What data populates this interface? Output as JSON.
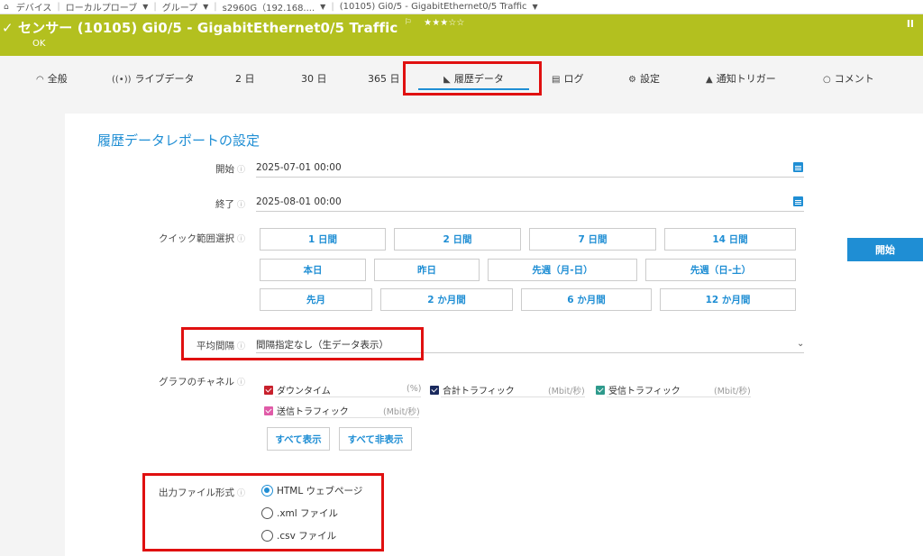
{
  "breadcrumb": [
    {
      "label": "デバイス",
      "caret": false
    },
    {
      "label": "ローカルプローブ",
      "caret": true
    },
    {
      "label": "グループ",
      "caret": true
    },
    {
      "label": "s2960G（192.168....",
      "caret": true
    },
    {
      "label": "(10105) Gi0/5 - GigabitEthernet0/5 Traffic",
      "caret": true
    }
  ],
  "header": {
    "check": "✓",
    "title": "センサー (10105) Gi0/5 - GigabitEthernet0/5 Traffic",
    "stars": "★★★☆☆",
    "status": "OK",
    "pause": "II"
  },
  "tabs": [
    {
      "label": "全般",
      "icon": "gauge-icon"
    },
    {
      "label": "ライブデータ",
      "icon": "broadcast-icon"
    },
    {
      "label": "2 日",
      "icon": ""
    },
    {
      "label": "30 日",
      "icon": ""
    },
    {
      "label": "365 日",
      "icon": ""
    },
    {
      "label": "履歴データ",
      "icon": "area-chart-icon",
      "active": true
    },
    {
      "label": "ログ",
      "icon": "list-icon"
    },
    {
      "label": "設定",
      "icon": "gear-icon"
    },
    {
      "label": "通知トリガー",
      "icon": "bell-icon"
    },
    {
      "label": "コメント",
      "icon": "comment-icon"
    }
  ],
  "form": {
    "title": "履歴データレポートの設定",
    "start_label": "開始",
    "start_value": "2025-07-01 00:00",
    "end_label": "終了",
    "end_value": "2025-08-01 00:00",
    "quick_label": "クイック範囲選択",
    "quick_row1": [
      "1 日間",
      "2 日間",
      "7 日間",
      "14 日間"
    ],
    "quick_row2": [
      "本日",
      "昨日",
      "先週（月-日）",
      "先週（日-土）"
    ],
    "quick_row3": [
      "先月",
      "2 か月間",
      "6 か月間",
      "12 か月間"
    ],
    "avg_label": "平均間隔",
    "avg_value": "間隔指定なし（生データ表示）",
    "channels_label": "グラフのチャネル",
    "channels": [
      {
        "name": "ダウンタイム",
        "unit": "(%)",
        "color": "#c8202c"
      },
      {
        "name": "合計トラフィック",
        "unit": "(Mbit/秒)",
        "color": "#1a2a5e"
      },
      {
        "name": "受信トラフィック",
        "unit": "(Mbit/秒)",
        "color": "#2e9a8c"
      },
      {
        "name": "送信トラフィック",
        "unit": "(Mbit/秒)",
        "color": "#e05ba8"
      }
    ],
    "show_all": "すべて表示",
    "hide_all": "すべて非表示",
    "format_label": "出力ファイル形式",
    "formats": [
      {
        "label": "HTML ウェブページ",
        "selected": true
      },
      {
        "label": ".xml ファイル",
        "selected": false
      },
      {
        "label": ".csv ファイル",
        "selected": false
      }
    ],
    "submit": "開始"
  },
  "colors": {
    "accent": "#1f8ed4",
    "header": "#b3c01f",
    "highlight": "#e01010"
  }
}
